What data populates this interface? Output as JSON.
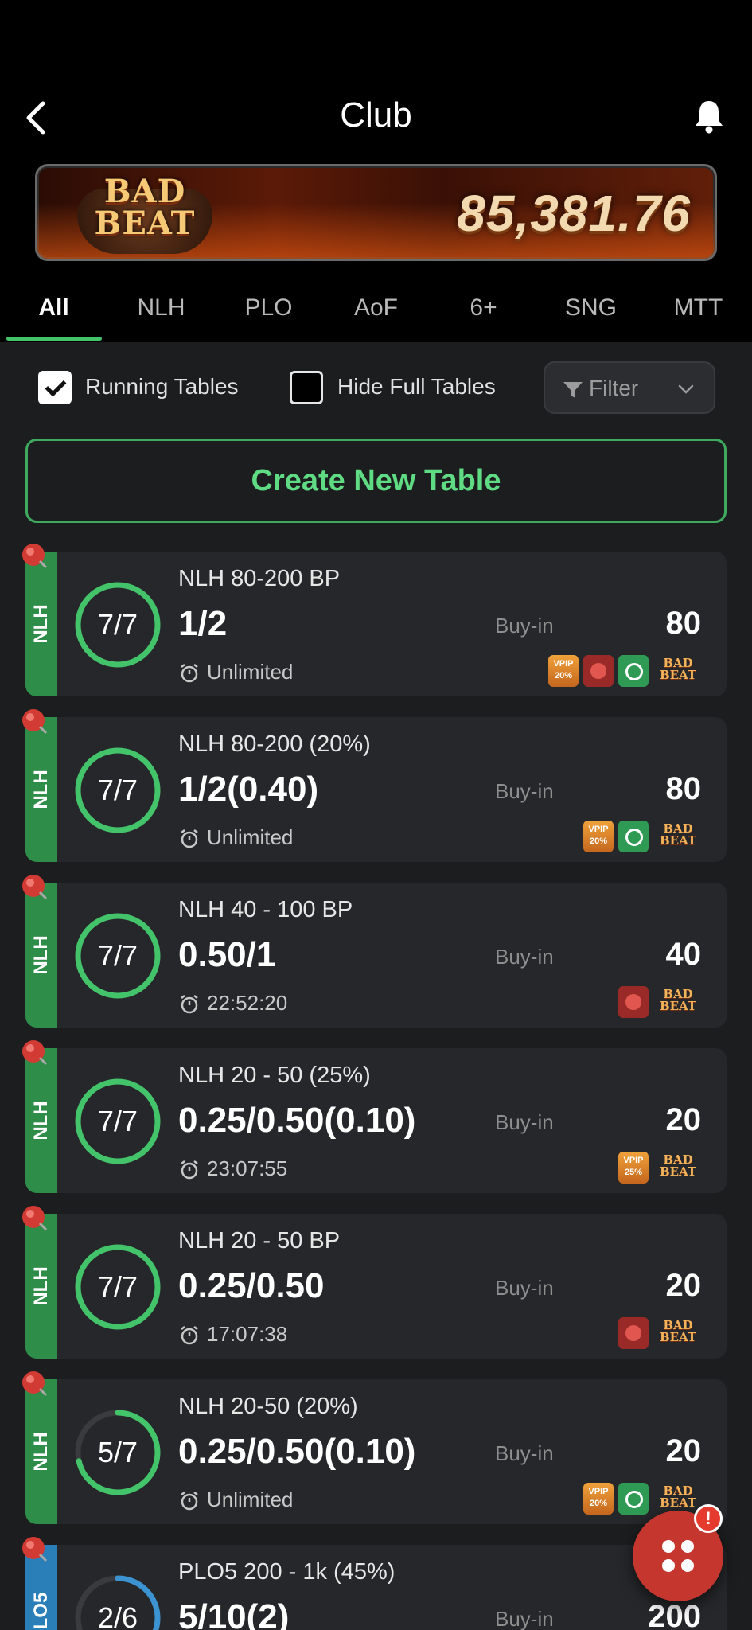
{
  "header": {
    "title": "Club",
    "back_icon": "chevron-left-icon",
    "bell_icon": "bell-icon"
  },
  "jackpot": {
    "logo_line1": "BAD",
    "logo_line2": "BEAT",
    "amount": "85,381.76"
  },
  "tabs": [
    {
      "label": "All",
      "active": true
    },
    {
      "label": "NLH",
      "active": false
    },
    {
      "label": "PLO",
      "active": false
    },
    {
      "label": "AoF",
      "active": false
    },
    {
      "label": "6+",
      "active": false
    },
    {
      "label": "SNG",
      "active": false
    },
    {
      "label": "MTT",
      "active": false
    }
  ],
  "filters": {
    "running_tables_label": "Running Tables",
    "running_tables_checked": true,
    "hide_full_label": "Hide Full Tables",
    "hide_full_checked": false,
    "filter_label": "Filter"
  },
  "create_button_label": "Create New Table",
  "colors": {
    "accent_green": "#43c36a",
    "nlh_stripe": "#2f8d4a",
    "plo_stripe": "#2a7fb8",
    "fab_red": "#c4362e"
  },
  "tables": [
    {
      "game": "NLH",
      "name": "NLH 80-200 BP",
      "blinds": "1/2",
      "seats": "7/7",
      "fill": 1.0,
      "time": "Unlimited",
      "buyin_label": "Buy-in",
      "buyin": "80",
      "badges": [
        {
          "type": "vpip",
          "text1": "VPIP",
          "text2": "20%"
        },
        {
          "type": "bomb"
        },
        {
          "type": "clock"
        },
        {
          "type": "badbeat",
          "text1": "BAD",
          "text2": "BEAT"
        }
      ]
    },
    {
      "game": "NLH",
      "name": "NLH 80-200 (20%)",
      "blinds": "1/2(0.40)",
      "seats": "7/7",
      "fill": 1.0,
      "time": "Unlimited",
      "buyin_label": "Buy-in",
      "buyin": "80",
      "badges": [
        {
          "type": "vpip",
          "text1": "VPIP",
          "text2": "20%"
        },
        {
          "type": "clock"
        },
        {
          "type": "badbeat",
          "text1": "BAD",
          "text2": "BEAT"
        }
      ]
    },
    {
      "game": "NLH",
      "name": "NLH 40 - 100 BP",
      "blinds": "0.50/1",
      "seats": "7/7",
      "fill": 1.0,
      "time": "22:52:20",
      "buyin_label": "Buy-in",
      "buyin": "40",
      "badges": [
        {
          "type": "bomb"
        },
        {
          "type": "badbeat",
          "text1": "BAD",
          "text2": "BEAT"
        }
      ]
    },
    {
      "game": "NLH",
      "name": "NLH 20 - 50 (25%)",
      "blinds": "0.25/0.50(0.10)",
      "seats": "7/7",
      "fill": 1.0,
      "time": "23:07:55",
      "buyin_label": "Buy-in",
      "buyin": "20",
      "badges": [
        {
          "type": "vpip",
          "text1": "VPIP",
          "text2": "25%"
        },
        {
          "type": "badbeat",
          "text1": "BAD",
          "text2": "BEAT"
        }
      ]
    },
    {
      "game": "NLH",
      "name": "NLH 20 - 50 BP",
      "blinds": "0.25/0.50",
      "seats": "7/7",
      "fill": 1.0,
      "time": "17:07:38",
      "buyin_label": "Buy-in",
      "buyin": "20",
      "badges": [
        {
          "type": "bomb"
        },
        {
          "type": "badbeat",
          "text1": "BAD",
          "text2": "BEAT"
        }
      ]
    },
    {
      "game": "NLH",
      "name": "NLH 20-50 (20%)",
      "blinds": "0.25/0.50(0.10)",
      "seats": "5/7",
      "fill": 0.714,
      "time": "Unlimited",
      "buyin_label": "Buy-in",
      "buyin": "20",
      "badges": [
        {
          "type": "vpip",
          "text1": "VPIP",
          "text2": "20%"
        },
        {
          "type": "clock"
        },
        {
          "type": "badbeat",
          "text1": "BAD",
          "text2": "BEAT"
        }
      ]
    },
    {
      "game": "PLO5",
      "name": "PLO5 200 - 1k (45%)",
      "blinds": "5/10(2)",
      "seats": "2/6",
      "fill": 0.333,
      "time": "",
      "buyin_label": "Buy-in",
      "buyin": "200",
      "badges": []
    }
  ],
  "fab": {
    "icon": "apps-grid-icon",
    "badge_text": "!"
  }
}
